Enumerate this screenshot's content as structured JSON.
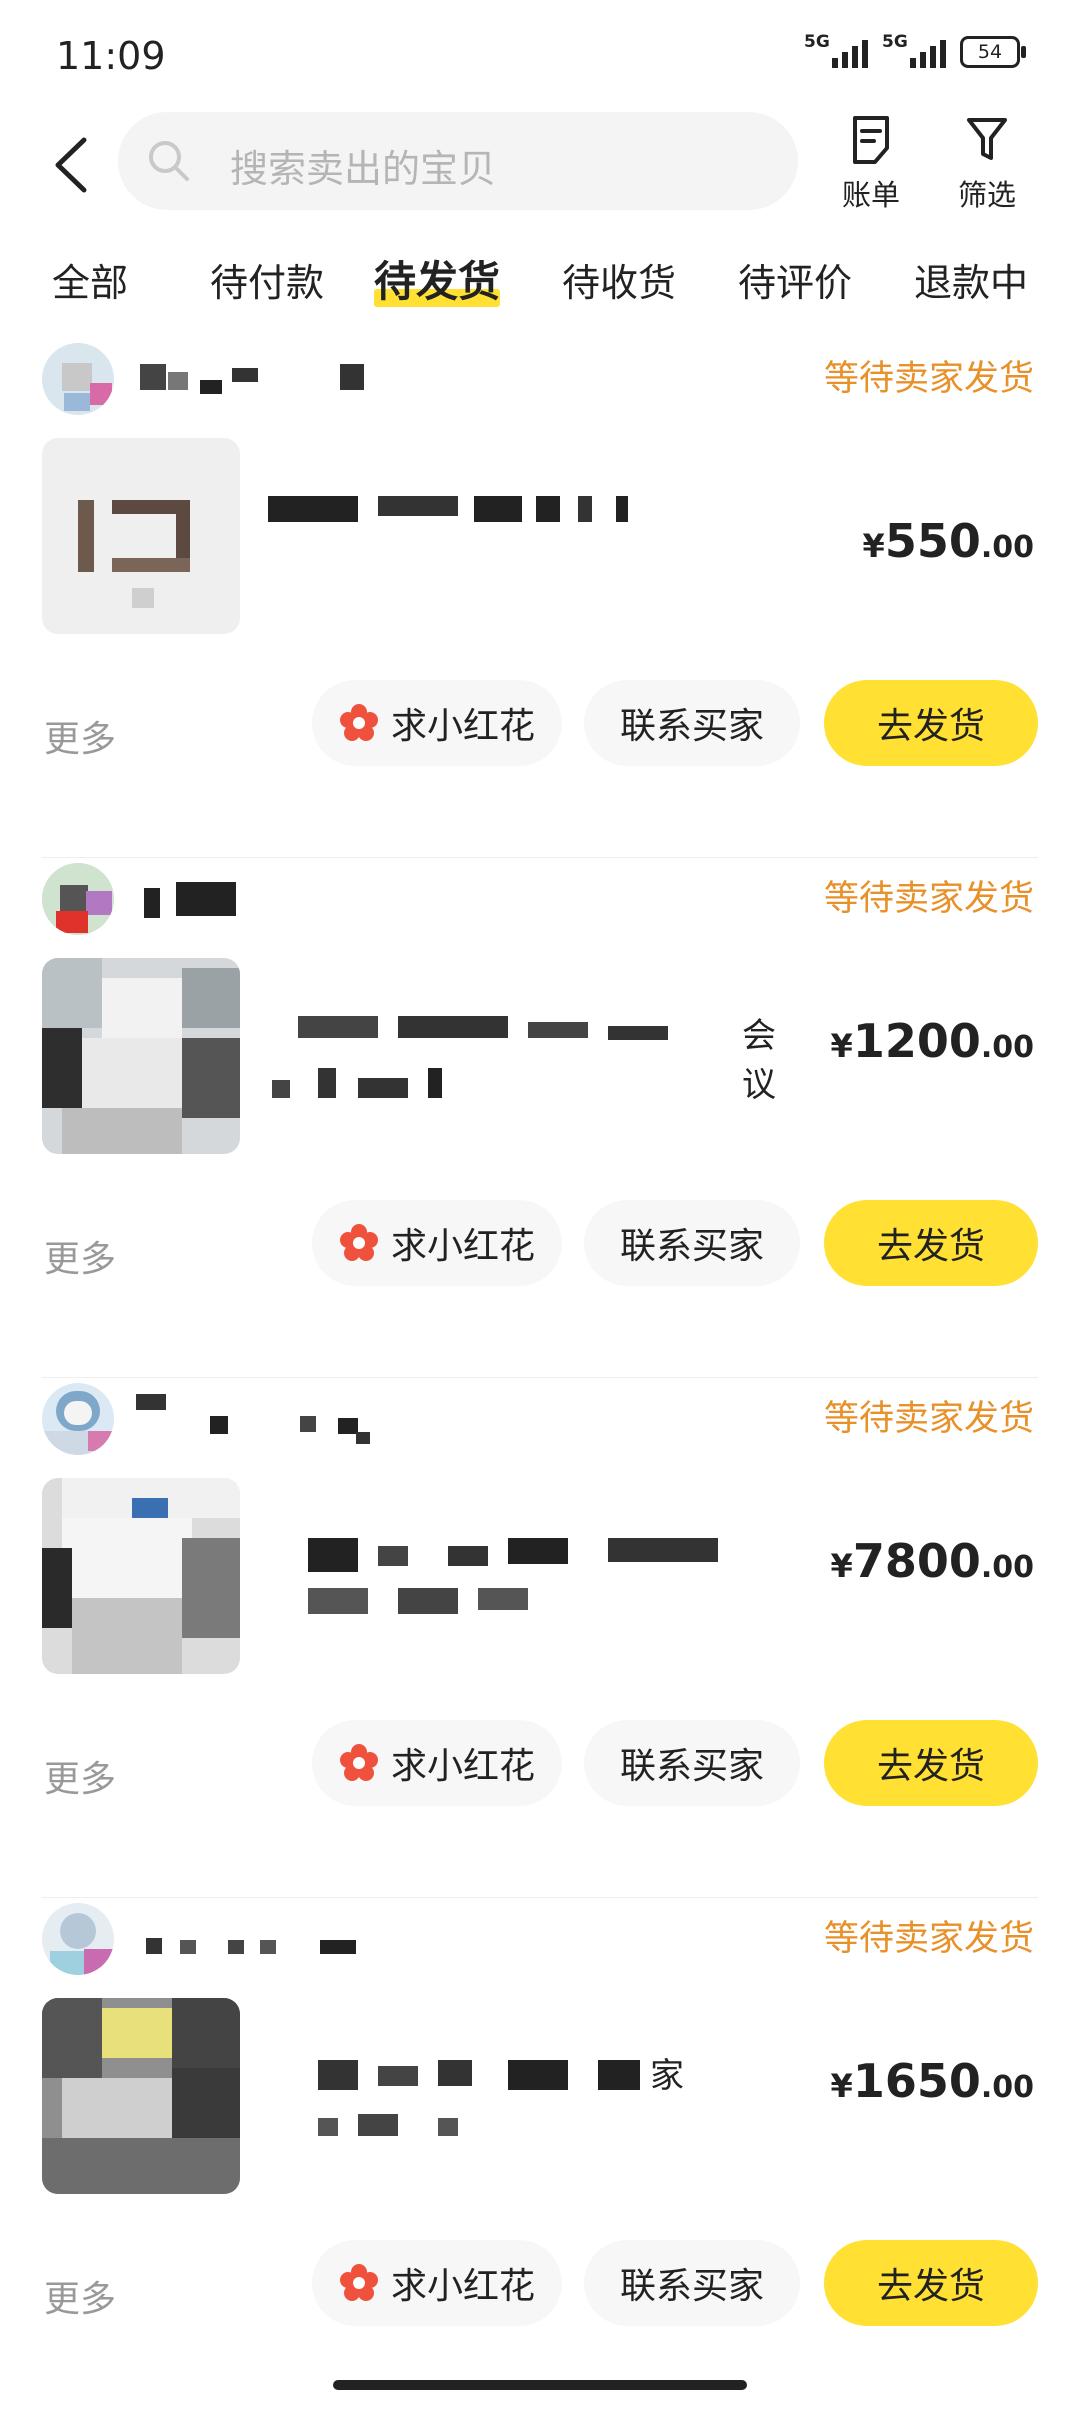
{
  "status_bar": {
    "time": "11:09",
    "network1": "5G",
    "network2": "5G",
    "battery": "54"
  },
  "header": {
    "search_placeholder": "搜索卖出的宝贝",
    "bill_label": "账单",
    "filter_label": "筛选"
  },
  "tabs": [
    {
      "label": "全部"
    },
    {
      "label": "待付款"
    },
    {
      "label": "待发货",
      "active": true
    },
    {
      "label": "待收货"
    },
    {
      "label": "待评价"
    },
    {
      "label": "退款中"
    }
  ],
  "orders": [
    {
      "status": "等待卖家发货",
      "title_visible": "",
      "currency": "¥",
      "price_int": "550",
      "price_dec": ".00",
      "more": "更多",
      "flower_btn": "求小红花",
      "contact_btn": "联系买家",
      "ship_btn": "去发货"
    },
    {
      "status": "等待卖家发货",
      "title_visible": "会议",
      "currency": "¥",
      "price_int": "1200",
      "price_dec": ".00",
      "more": "更多",
      "flower_btn": "求小红花",
      "contact_btn": "联系买家",
      "ship_btn": "去发货"
    },
    {
      "status": "等待卖家发货",
      "title_visible": "",
      "currency": "¥",
      "price_int": "7800",
      "price_dec": ".00",
      "more": "更多",
      "flower_btn": "求小红花",
      "contact_btn": "联系买家",
      "ship_btn": "去发货"
    },
    {
      "status": "等待卖家发货",
      "title_visible": "家",
      "currency": "¥",
      "price_int": "1650",
      "price_dec": ".00",
      "more": "更多",
      "flower_btn": "求小红花",
      "contact_btn": "联系买家",
      "ship_btn": "去发货"
    }
  ],
  "colors": {
    "accent": "#FFE033",
    "status": "#E8902A",
    "muted": "#999999"
  }
}
